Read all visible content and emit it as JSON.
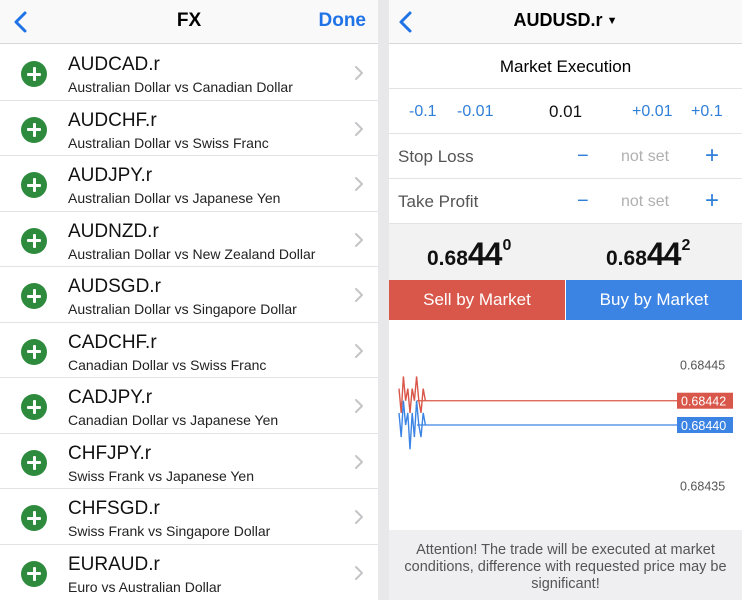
{
  "left": {
    "title": "FX",
    "done_label": "Done",
    "symbols": [
      {
        "name": "AUDCAD.r",
        "desc": "Australian Dollar vs Canadian Dollar"
      },
      {
        "name": "AUDCHF.r",
        "desc": "Australian Dollar vs Swiss Franc"
      },
      {
        "name": "AUDJPY.r",
        "desc": "Australian Dollar vs Japanese Yen"
      },
      {
        "name": "AUDNZD.r",
        "desc": "Australian Dollar vs New Zealand Dollar"
      },
      {
        "name": "AUDSGD.r",
        "desc": "Australian Dollar vs Singapore Dollar"
      },
      {
        "name": "CADCHF.r",
        "desc": "Canadian Dollar vs Swiss Franc"
      },
      {
        "name": "CADJPY.r",
        "desc": "Canadian Dollar vs Japanese Yen"
      },
      {
        "name": "CHFJPY.r",
        "desc": "Swiss Frank vs Japanese Yen"
      },
      {
        "name": "CHFSGD.r",
        "desc": "Swiss Frank vs Singapore Dollar"
      },
      {
        "name": "EURAUD.r",
        "desc": "Euro vs Australian Dollar"
      }
    ]
  },
  "right": {
    "symbol": "AUDUSD.r",
    "caret": "▼",
    "execution": "Market Execution",
    "volume": {
      "dec_large": "-0.1",
      "dec_small": "-0.01",
      "value": "0.01",
      "inc_small": "+0.01",
      "inc_large": "+0.1"
    },
    "stop_loss": {
      "label": "Stop Loss",
      "minus": "−",
      "value": "not set",
      "plus": "+"
    },
    "take_profit": {
      "label": "Take Profit",
      "minus": "−",
      "value": "not set",
      "plus": "+"
    },
    "bid": {
      "small": "0.68",
      "big": "44",
      "sup": "0"
    },
    "ask": {
      "small": "0.68",
      "big": "44",
      "sup": "2"
    },
    "sell_label": "Sell by Market",
    "buy_label": "Buy by Market",
    "attention": "Attention! The trade will be executed at market conditions, difference with requested price may be significant!"
  },
  "colors": {
    "accent": "#1f73e6",
    "add_green": "#2e8b3e",
    "sell": "#d9574a",
    "buy": "#3c84e4"
  },
  "chart_data": {
    "type": "line",
    "y_ticks": [
      "0.68445",
      "0.68435"
    ],
    "ask_level": "0.68442",
    "bid_level": "0.68440",
    "ylim": [
      0.68433,
      0.68447
    ],
    "series": [
      {
        "values": [
          0.68443,
          0.68441,
          0.68444,
          0.68442,
          0.68443,
          0.68441,
          0.68443,
          0.68442,
          0.68444,
          0.68442,
          0.68441,
          0.68443,
          0.68442
        ]
      },
      {
        "values": [
          0.68441,
          0.68439,
          0.68442,
          0.6844,
          0.68441,
          0.68438,
          0.68441,
          0.68439,
          0.68442,
          0.6844,
          0.68439,
          0.68441,
          0.6844
        ]
      }
    ]
  }
}
